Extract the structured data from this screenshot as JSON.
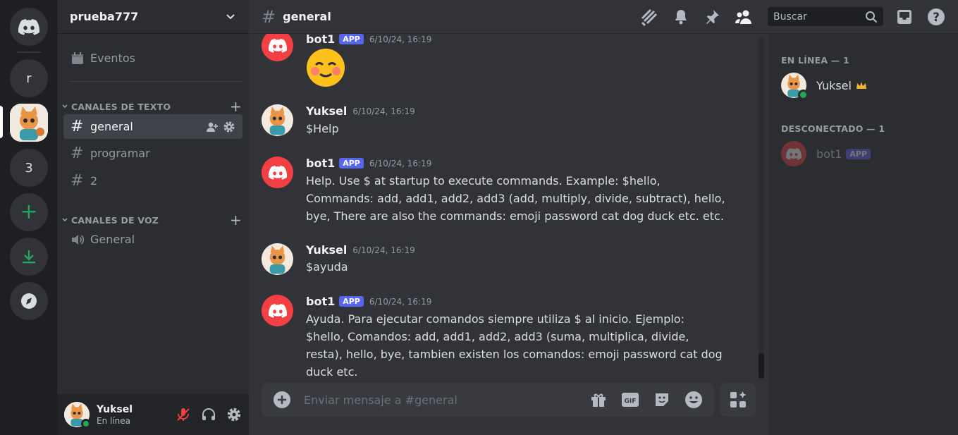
{
  "server": {
    "name": "prueba777",
    "rail_items": [
      {
        "label": "r"
      },
      {
        "label": "3"
      }
    ]
  },
  "sidebar": {
    "events_label": "Eventos",
    "text_category": "CANALES DE TEXTO",
    "voice_category": "CANALES DE VOZ",
    "text_channels": [
      {
        "label": "general",
        "active": true
      },
      {
        "label": "programar",
        "active": false
      },
      {
        "label": "2",
        "active": false
      }
    ],
    "voice_channels": [
      {
        "label": "General"
      }
    ]
  },
  "user": {
    "name": "Yuksel",
    "status": "En línea"
  },
  "header": {
    "channel": "general",
    "search_placeholder": "Buscar"
  },
  "messages": [
    {
      "author": "bot1",
      "tag": "APP",
      "timestamp": "6/10/24, 16:19",
      "text": ""
    },
    {
      "author": "Yuksel",
      "tag": "",
      "timestamp": "6/10/24, 16:19",
      "text": "$Help"
    },
    {
      "author": "bot1",
      "tag": "APP",
      "timestamp": "6/10/24, 16:19",
      "text": "Help. Use $ at startup to execute commands. Example: $hello, Commands: add, add1, add2, add3 (add, multiply, divide, subtract), hello, bye, There are also the commands: emoji password cat dog duck etc. etc."
    },
    {
      "author": "Yuksel",
      "tag": "",
      "timestamp": "6/10/24, 16:19",
      "text": "$ayuda"
    },
    {
      "author": "bot1",
      "tag": "APP",
      "timestamp": "6/10/24, 16:19",
      "text": "Ayuda. Para ejecutar comandos siempre utiliza $ al inicio. Ejemplo: $hello, Comandos: add, add1, add2, add3 (suma, multiplica, divide, resta), hello, bye, tambien existen los comandos: emoji password cat dog duck etc."
    }
  ],
  "composer": {
    "placeholder": "Enviar mensaje a #general"
  },
  "members": {
    "online_header": "EN LÍNEA — 1",
    "offline_header": "DESCONECTADO — 1",
    "online": [
      {
        "name": "Yuksel",
        "owner": true
      }
    ],
    "offline": [
      {
        "name": "bot1",
        "tag": "APP"
      }
    ]
  },
  "colors": {
    "accent": "#5865f2",
    "online": "#23a55a",
    "bot_avatar": "#f23f43",
    "add_server": "#23a55a"
  }
}
